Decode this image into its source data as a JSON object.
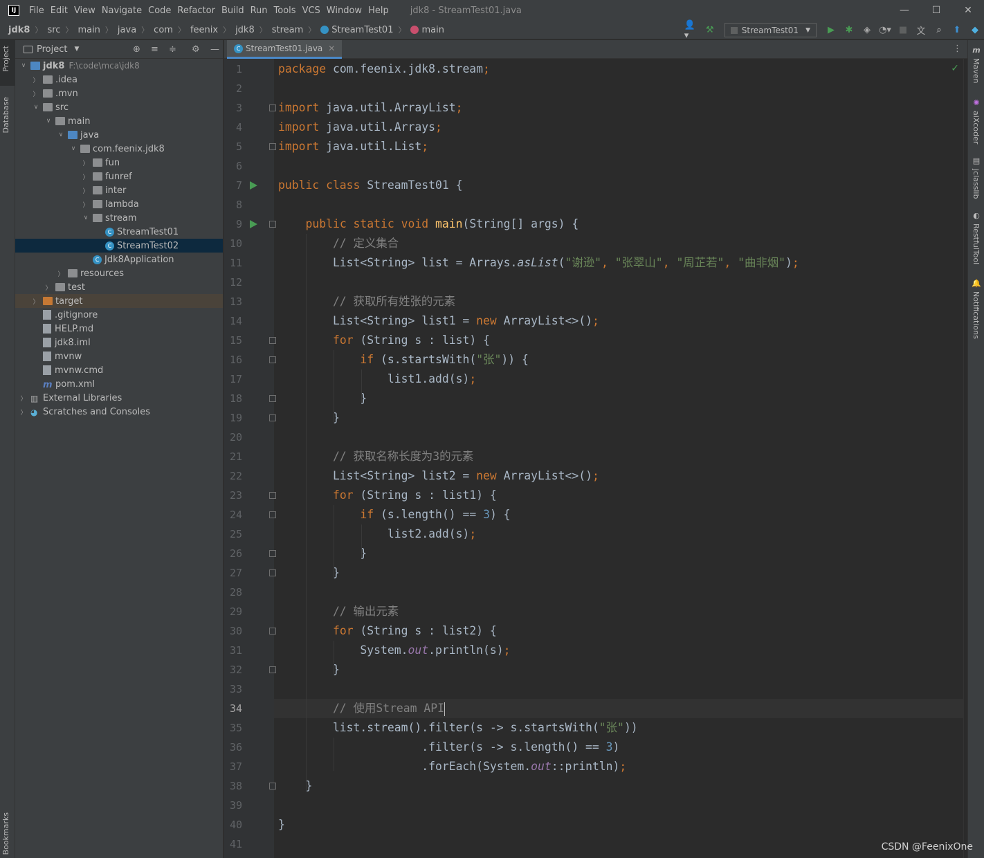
{
  "app": {
    "logo": "IJ",
    "window_title": "jdk8 - StreamTest01.java",
    "menu": [
      "File",
      "Edit",
      "View",
      "Navigate",
      "Code",
      "Refactor",
      "Build",
      "Run",
      "Tools",
      "VCS",
      "Window",
      "Help"
    ]
  },
  "breadcrumb": [
    "jdk8",
    "src",
    "main",
    "java",
    "com",
    "feenix",
    "jdk8",
    "stream",
    "StreamTest01",
    "main"
  ],
  "toolbar": {
    "run_config": "StreamTest01"
  },
  "left_strip": {
    "project_tab": "Project",
    "database_tab": "Database",
    "bookmarks_tab": "Bookmarks"
  },
  "right_strip": {
    "maven_tab": "Maven",
    "aixcoder_tab": "aiXcoder",
    "jclasslib_tab": "jclasslib",
    "restful_tab": "RestfulTool",
    "notifications_tab": "Notifications"
  },
  "project": {
    "title": "Project",
    "tree": [
      {
        "label": "jdk8",
        "hint": "F:\\code\\mca\\jdk8",
        "depth": 0,
        "chev": "down",
        "icon": "module"
      },
      {
        "label": ".idea",
        "depth": 1,
        "chev": "right",
        "icon": "folder"
      },
      {
        "label": ".mvn",
        "depth": 1,
        "chev": "right",
        "icon": "folder"
      },
      {
        "label": "src",
        "depth": 1,
        "chev": "down",
        "icon": "folder"
      },
      {
        "label": "main",
        "depth": 2,
        "chev": "down",
        "icon": "folder"
      },
      {
        "label": "java",
        "depth": 3,
        "chev": "down",
        "icon": "folder-blue"
      },
      {
        "label": "com.feenix.jdk8",
        "depth": 4,
        "chev": "down",
        "icon": "package"
      },
      {
        "label": "fun",
        "depth": 5,
        "chev": "right",
        "icon": "package"
      },
      {
        "label": "funref",
        "depth": 5,
        "chev": "right",
        "icon": "package"
      },
      {
        "label": "inter",
        "depth": 5,
        "chev": "right",
        "icon": "package"
      },
      {
        "label": "lambda",
        "depth": 5,
        "chev": "right",
        "icon": "package"
      },
      {
        "label": "stream",
        "depth": 5,
        "chev": "down",
        "icon": "package"
      },
      {
        "label": "StreamTest01",
        "depth": 6,
        "chev": "none",
        "icon": "class"
      },
      {
        "label": "StreamTest02",
        "depth": 6,
        "chev": "none",
        "icon": "class",
        "selected": true
      },
      {
        "label": "Jdk8Application",
        "depth": 5,
        "chev": "none",
        "icon": "class"
      },
      {
        "label": "resources",
        "depth": 3,
        "chev": "right",
        "icon": "folder"
      },
      {
        "label": "test",
        "depth": 2,
        "chev": "right",
        "icon": "folder"
      },
      {
        "label": "target",
        "depth": 1,
        "chev": "right",
        "icon": "folder-orange",
        "excluded": true
      },
      {
        "label": ".gitignore",
        "depth": 1,
        "chev": "none",
        "icon": "file"
      },
      {
        "label": "HELP.md",
        "depth": 1,
        "chev": "none",
        "icon": "file"
      },
      {
        "label": "jdk8.iml",
        "depth": 1,
        "chev": "none",
        "icon": "file"
      },
      {
        "label": "mvnw",
        "depth": 1,
        "chev": "none",
        "icon": "file"
      },
      {
        "label": "mvnw.cmd",
        "depth": 1,
        "chev": "none",
        "icon": "file"
      },
      {
        "label": "pom.xml",
        "depth": 1,
        "chev": "none",
        "icon": "maven"
      },
      {
        "label": "External Libraries",
        "depth": 0,
        "chev": "right",
        "icon": "libs"
      },
      {
        "label": "Scratches and Consoles",
        "depth": 0,
        "chev": "right",
        "icon": "scratch"
      }
    ]
  },
  "editor": {
    "tab_label": "StreamTest01.java",
    "current_line": 34,
    "run_lines": [
      7,
      9
    ],
    "fold_lines": [
      3,
      5,
      9,
      15,
      16,
      18,
      19,
      23,
      24,
      26,
      27,
      30,
      32,
      38
    ],
    "lines": [
      [
        [
          "kw",
          "package"
        ],
        [
          "t",
          " com.feenix.jdk8.stream"
        ],
        [
          "kw",
          ";"
        ]
      ],
      [],
      [
        [
          "kw",
          "import"
        ],
        [
          "t",
          " java.util.ArrayList"
        ],
        [
          "kw",
          ";"
        ]
      ],
      [
        [
          "kw",
          "import"
        ],
        [
          "t",
          " java.util.Arrays"
        ],
        [
          "kw",
          ";"
        ]
      ],
      [
        [
          "kw",
          "import"
        ],
        [
          "t",
          " java.util.List"
        ],
        [
          "kw",
          ";"
        ]
      ],
      [],
      [
        [
          "kw",
          "public class"
        ],
        [
          "t",
          " StreamTest01 {"
        ]
      ],
      [],
      [
        [
          "t",
          "    "
        ],
        [
          "kw",
          "public static void"
        ],
        [
          "t",
          " "
        ],
        [
          "fn",
          "main"
        ],
        [
          "t",
          "(String[] args) {"
        ]
      ],
      [
        [
          "cm",
          "        // 定义集合"
        ]
      ],
      [
        [
          "t",
          "        List<String> list = Arrays."
        ],
        [
          "sit",
          "asList"
        ],
        [
          "t",
          "("
        ],
        [
          "str",
          "\"谢逊\""
        ],
        [
          "kw",
          ", "
        ],
        [
          "str",
          "\"张翠山\""
        ],
        [
          "kw",
          ", "
        ],
        [
          "str",
          "\"周芷若\""
        ],
        [
          "kw",
          ", "
        ],
        [
          "str",
          "\"曲非烟\""
        ],
        [
          "t",
          ")"
        ],
        [
          "kw",
          ";"
        ]
      ],
      [],
      [
        [
          "cm",
          "        // 获取所有姓张的元素"
        ]
      ],
      [
        [
          "t",
          "        List<String> list1 = "
        ],
        [
          "kw",
          "new"
        ],
        [
          "t",
          " ArrayList<>()"
        ],
        [
          "kw",
          ";"
        ]
      ],
      [
        [
          "t",
          "        "
        ],
        [
          "kw",
          "for"
        ],
        [
          "t",
          " (String s : list) {"
        ]
      ],
      [
        [
          "t",
          "            "
        ],
        [
          "kw",
          "if"
        ],
        [
          "t",
          " (s.startsWith("
        ],
        [
          "str",
          "\"张\""
        ],
        [
          "t",
          ")) {"
        ]
      ],
      [
        [
          "t",
          "                list1.add(s)"
        ],
        [
          "kw",
          ";"
        ]
      ],
      [
        [
          "t",
          "            }"
        ]
      ],
      [
        [
          "t",
          "        }"
        ]
      ],
      [],
      [
        [
          "cm",
          "        // 获取名称长度为3的元素"
        ]
      ],
      [
        [
          "t",
          "        List<String> list2 = "
        ],
        [
          "kw",
          "new"
        ],
        [
          "t",
          " ArrayList<>()"
        ],
        [
          "kw",
          ";"
        ]
      ],
      [
        [
          "t",
          "        "
        ],
        [
          "kw",
          "for"
        ],
        [
          "t",
          " (String s : list1) {"
        ]
      ],
      [
        [
          "t",
          "            "
        ],
        [
          "kw",
          "if"
        ],
        [
          "t",
          " (s.length() == "
        ],
        [
          "num",
          "3"
        ],
        [
          "t",
          ") {"
        ]
      ],
      [
        [
          "t",
          "                list2.add(s)"
        ],
        [
          "kw",
          ";"
        ]
      ],
      [
        [
          "t",
          "            }"
        ]
      ],
      [
        [
          "t",
          "        }"
        ]
      ],
      [],
      [
        [
          "cm",
          "        // 输出元素"
        ]
      ],
      [
        [
          "t",
          "        "
        ],
        [
          "kw",
          "for"
        ],
        [
          "t",
          " (String s : list2) {"
        ]
      ],
      [
        [
          "t",
          "            System."
        ],
        [
          "it",
          "out"
        ],
        [
          "t",
          ".println(s)"
        ],
        [
          "kw",
          ";"
        ]
      ],
      [
        [
          "t",
          "        }"
        ]
      ],
      [],
      [
        [
          "cm",
          "        // 使用Stream API"
        ]
      ],
      [
        [
          "t",
          "        list.stream().filter(s -> s.startsWith("
        ],
        [
          "str",
          "\"张\""
        ],
        [
          "t",
          "))"
        ]
      ],
      [
        [
          "t",
          "                     .filter(s -> s.length() == "
        ],
        [
          "num",
          "3"
        ],
        [
          "t",
          ")"
        ]
      ],
      [
        [
          "t",
          "                     .forEach(System."
        ],
        [
          "it",
          "out"
        ],
        [
          "t",
          "::println)"
        ],
        [
          "kw",
          ";"
        ]
      ],
      [
        [
          "t",
          "    }"
        ]
      ],
      [],
      [
        [
          "t",
          "}"
        ]
      ],
      []
    ]
  },
  "watermark": "CSDN @FeenixOne"
}
